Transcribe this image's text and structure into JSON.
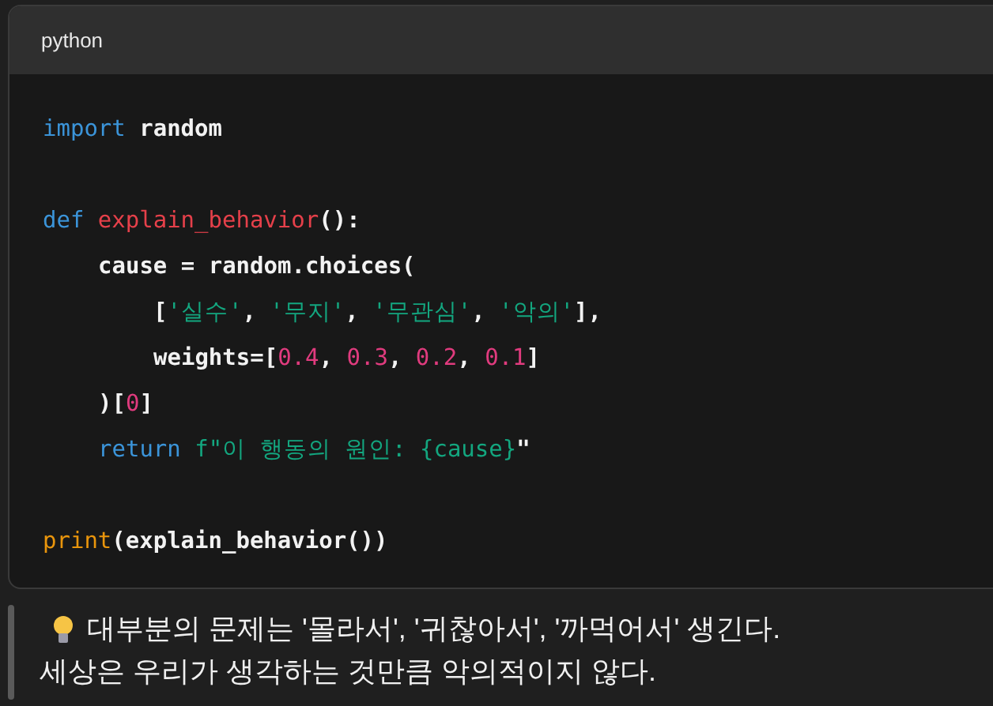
{
  "code_block": {
    "language": "python",
    "lines": [
      {
        "kind": "code",
        "tokens": [
          {
            "kind": "keyword",
            "text": "import "
          },
          {
            "kind": "plain",
            "text": "random"
          }
        ]
      },
      {
        "kind": "blank"
      },
      {
        "kind": "code",
        "tokens": [
          {
            "kind": "keyword",
            "text": "def "
          },
          {
            "kind": "function",
            "text": "explain_behavior"
          },
          {
            "kind": "plain",
            "text": "():"
          }
        ],
        "children": [
          {
            "kind": "code",
            "tokens": [
              {
                "kind": "plain",
                "text": "cause = random.choices("
              }
            ],
            "children": [
              {
                "kind": "code",
                "tokens": [
                  {
                    "kind": "plain",
                    "text": "["
                  },
                  {
                    "kind": "string",
                    "text": "'실수'"
                  },
                  {
                    "kind": "plain",
                    "text": ", "
                  },
                  {
                    "kind": "string",
                    "text": "'무지'"
                  },
                  {
                    "kind": "plain",
                    "text": ", "
                  },
                  {
                    "kind": "string",
                    "text": "'무관심'"
                  },
                  {
                    "kind": "plain",
                    "text": ", "
                  },
                  {
                    "kind": "string",
                    "text": "'악의'"
                  },
                  {
                    "kind": "plain",
                    "text": "],"
                  }
                ]
              },
              {
                "kind": "code",
                "tokens": [
                  {
                    "kind": "plain",
                    "text": "weights=["
                  },
                  {
                    "kind": "number",
                    "text": "0.4"
                  },
                  {
                    "kind": "plain",
                    "text": ", "
                  },
                  {
                    "kind": "number",
                    "text": "0.3"
                  },
                  {
                    "kind": "plain",
                    "text": ", "
                  },
                  {
                    "kind": "number",
                    "text": "0.2"
                  },
                  {
                    "kind": "plain",
                    "text": ", "
                  },
                  {
                    "kind": "number",
                    "text": "0.1"
                  },
                  {
                    "kind": "plain",
                    "text": "]"
                  }
                ]
              }
            ]
          },
          {
            "kind": "code",
            "tokens": [
              {
                "kind": "plain",
                "text": ")["
              },
              {
                "kind": "number",
                "text": "0"
              },
              {
                "kind": "plain",
                "text": "]"
              }
            ]
          },
          {
            "kind": "code",
            "tokens": [
              {
                "kind": "keyword",
                "text": "return "
              },
              {
                "kind": "string",
                "text": "f\"이 행동의 원인: {cause}"
              },
              {
                "kind": "plain",
                "text": "\""
              }
            ]
          }
        ]
      },
      {
        "kind": "blank"
      },
      {
        "kind": "code",
        "tokens": [
          {
            "kind": "builtin",
            "text": "print"
          },
          {
            "kind": "plain",
            "text": "(explain_behavior())"
          }
        ]
      }
    ]
  },
  "quote": {
    "lines": [
      "대부분의 문제는 '몰라서', '귀찮아서', '까먹어서' 생긴다.",
      "세상은 우리가 생각하는 것만큼 악의적이지 않다."
    ]
  }
}
